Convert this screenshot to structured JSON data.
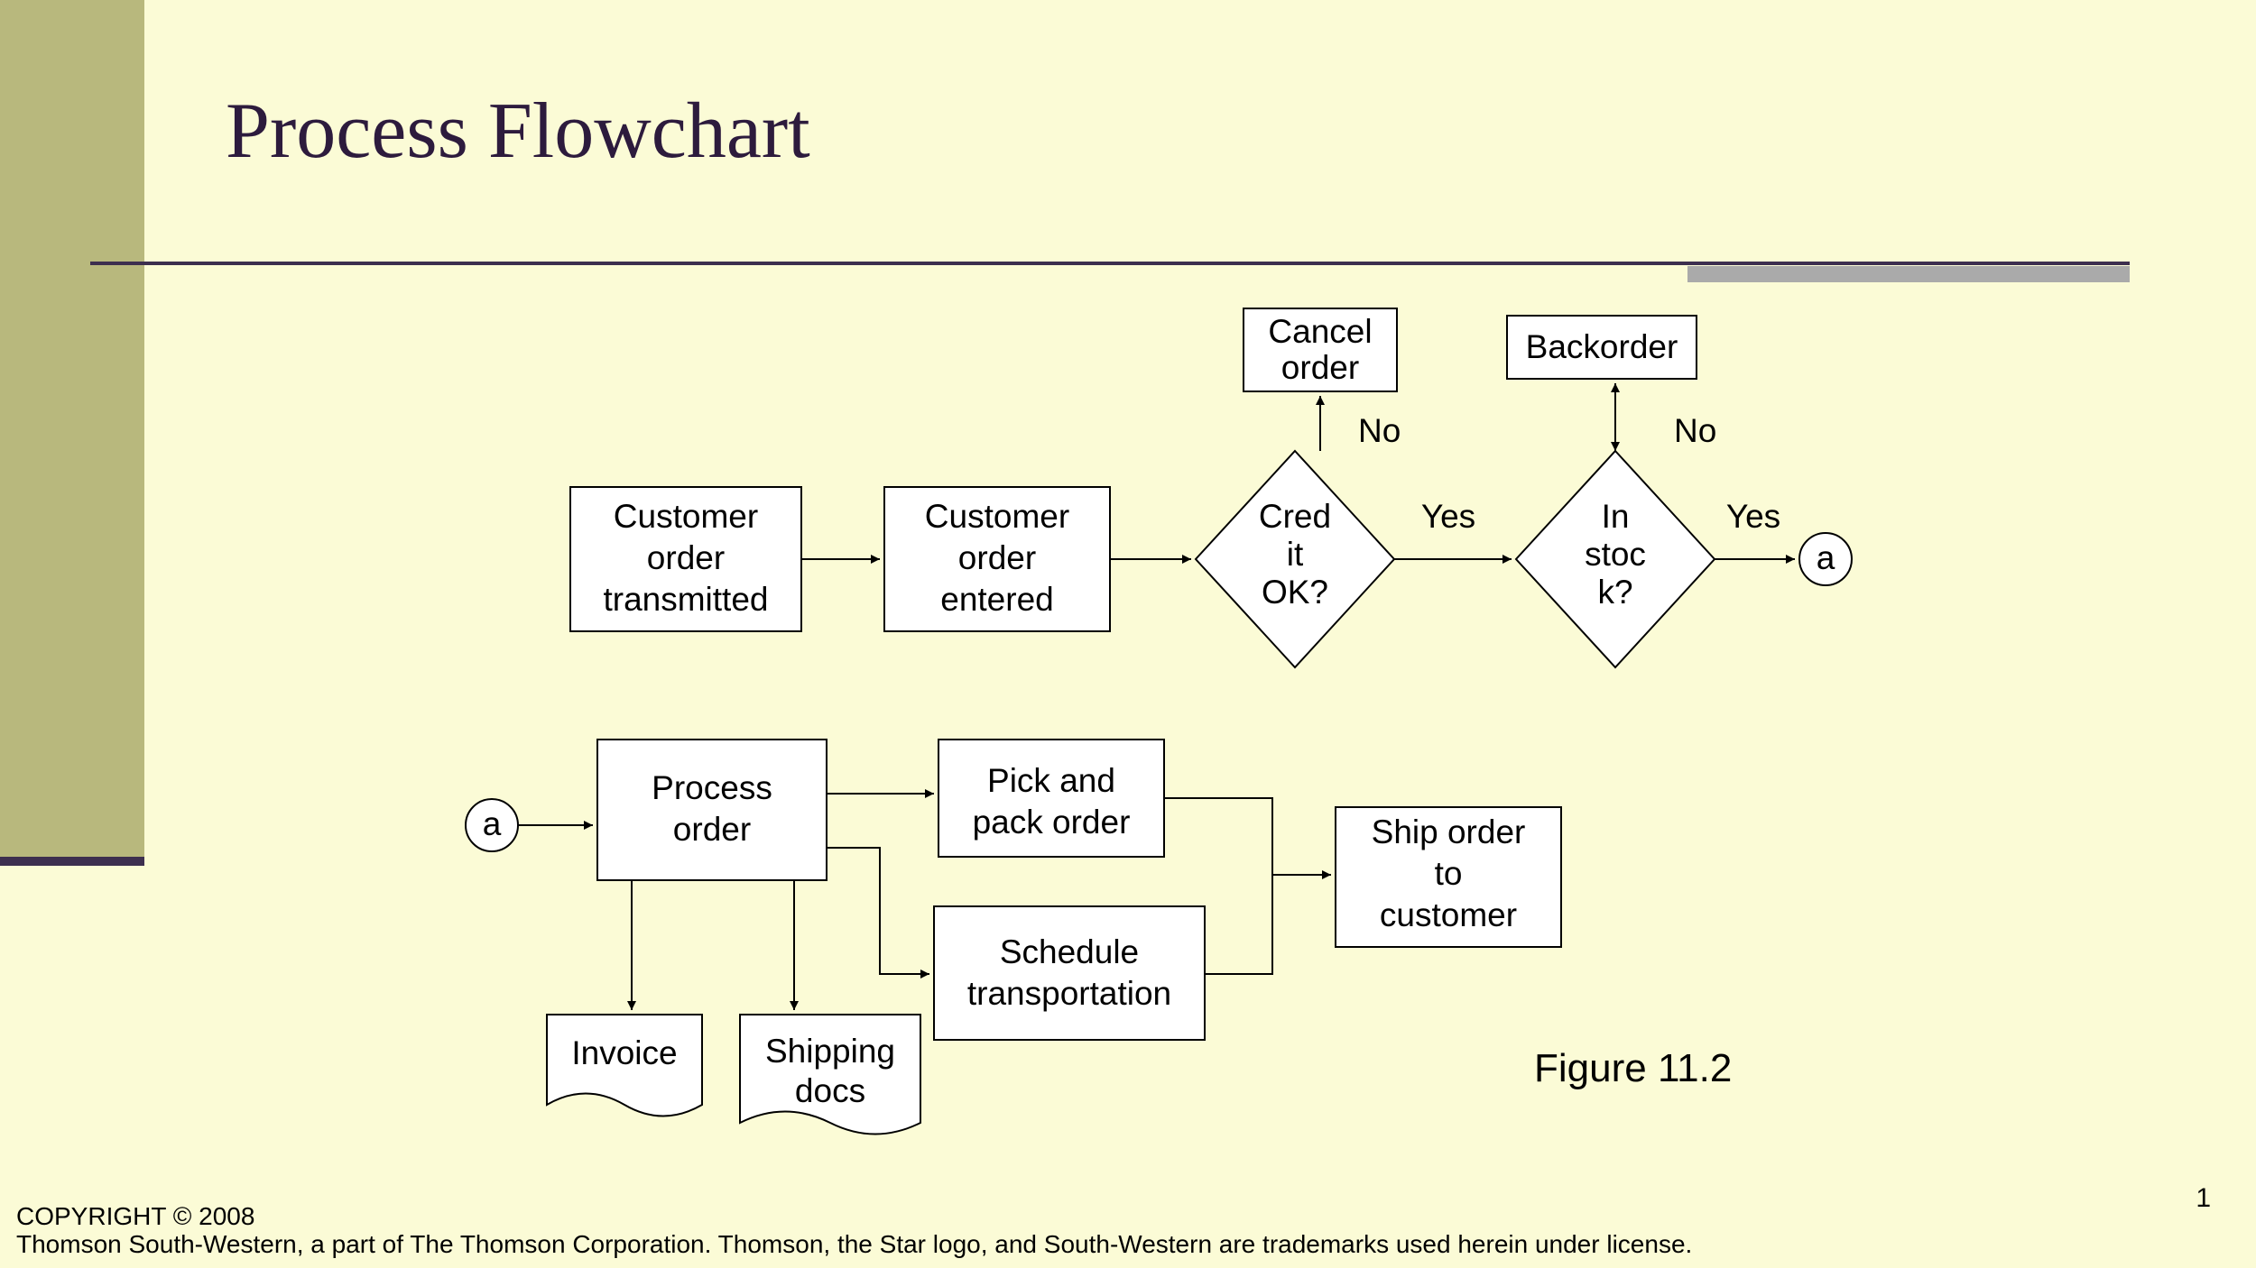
{
  "title": "Process Flowchart",
  "figure_label": "Figure 11.2",
  "page_number": "1",
  "copyright_line1": "COPYRIGHT © 2008",
  "copyright_line2": "Thomson South-Western, a part of The Thomson Corporation. Thomson, the Star logo, and South-Western are trademarks used herein under license.",
  "nodes": {
    "cust_order_trans": "Customer order transmitted",
    "cust_order_entered": "Customer order entered",
    "credit_ok": "Credit OK?",
    "in_stock": "In stock?",
    "cancel_order": "Cancel order",
    "backorder": "Backorder",
    "connector_a_top": "a",
    "connector_a_bot": "a",
    "process_order": "Process order",
    "pick_pack": "Pick and pack order",
    "schedule_trans": "Schedule transportation",
    "ship_order": "Ship order to customer",
    "invoice": "Invoice",
    "shipping_docs": "Shipping docs"
  },
  "edge_labels": {
    "credit_no": "No",
    "credit_yes": "Yes",
    "stock_no": "No",
    "stock_yes": "Yes"
  }
}
